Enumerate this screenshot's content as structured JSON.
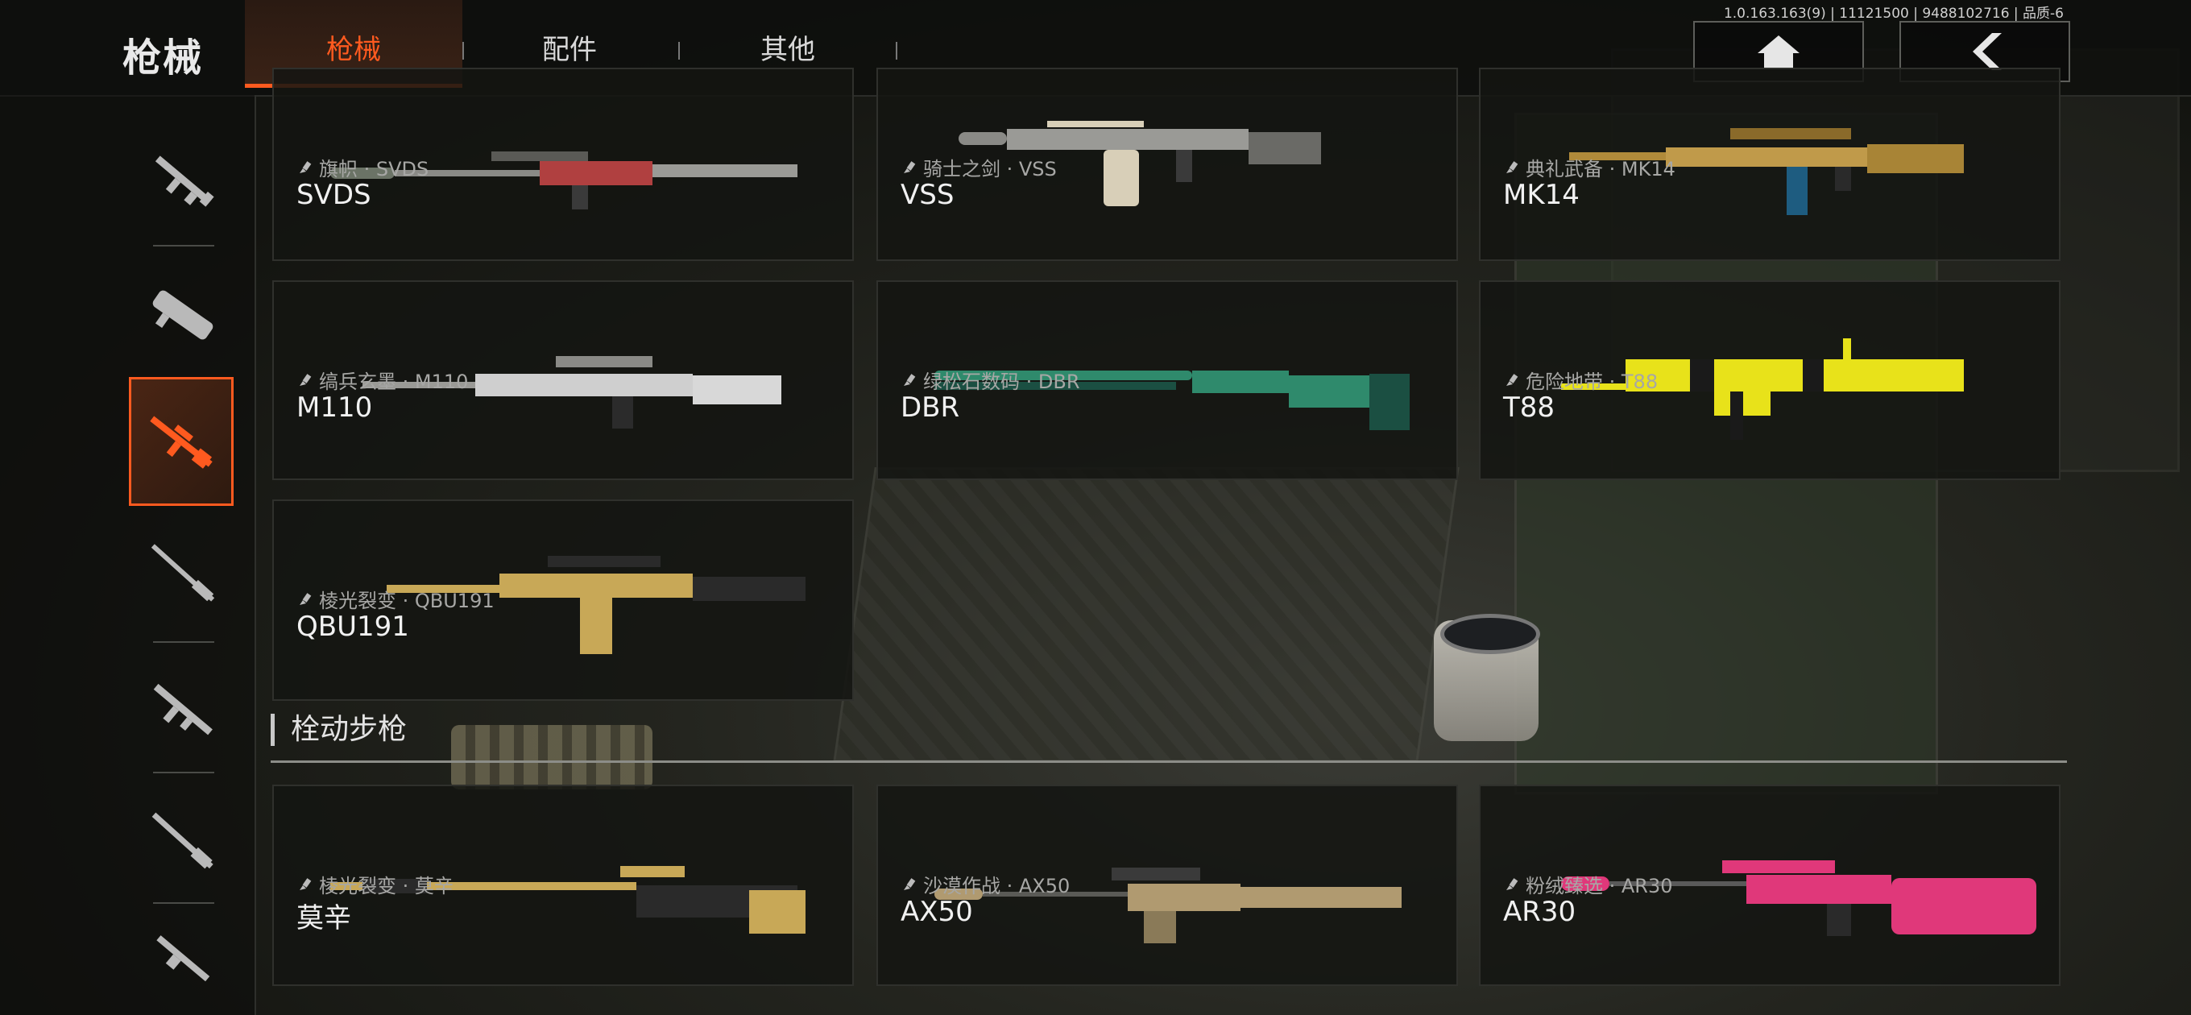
{
  "meta": {
    "version": "1.0.163.163(9) | 11121500 | 9488102716 | 品质-6"
  },
  "header": {
    "title": "枪械",
    "tabs": [
      {
        "label": "枪械"
      },
      {
        "label": "配件"
      },
      {
        "label": "其他"
      }
    ]
  },
  "icons": {
    "home": "home-icon",
    "back": "chevron-left-icon",
    "sidebar": [
      "assault-rifle-icon",
      "smg-icon",
      "dmr-icon",
      "sniper-icon",
      "rifle-icon",
      "shotgun-icon",
      "lmg-icon"
    ],
    "skin_tag": "paint-brush-icon"
  },
  "colors": {
    "accent": "#ff5a1f",
    "panel": "#141512"
  },
  "cards": [
    {
      "skin": "旗帜 · SVDS",
      "name": "SVDS",
      "palette": [
        "#6b7366",
        "#b04040"
      ]
    },
    {
      "skin": "骑士之剑 · VSS",
      "name": "VSS",
      "palette": [
        "#8a8a86",
        "#d8cfb8"
      ]
    },
    {
      "skin": "典礼武备 · MK14",
      "name": "MK14",
      "palette": [
        "#b08a3a",
        "#1e5c80"
      ]
    },
    {
      "skin": "缟兵玄墨 · M110",
      "name": "M110",
      "palette": [
        "#cfcfcf",
        "#2b2b2b"
      ]
    },
    {
      "skin": "绿松石数码 · DBR",
      "name": "DBR",
      "palette": [
        "#2f8a6c",
        "#1b4f42"
      ]
    },
    {
      "skin": "危险地带 · T88",
      "name": "T88",
      "palette": [
        "#e8e21a",
        "#1a1a1a"
      ]
    },
    {
      "skin": "棱光裂变 · QBU191",
      "name": "QBU191",
      "palette": [
        "#c8a857",
        "#2a2a2a"
      ]
    }
  ],
  "section": {
    "title": "栓动步枪"
  },
  "bolt_cards": [
    {
      "skin": "棱光裂变 · 莫辛",
      "name": "莫辛",
      "palette": [
        "#c8a857",
        "#2a2a2a"
      ]
    },
    {
      "skin": "沙漠作战 · AX50",
      "name": "AX50",
      "palette": [
        "#b09a70",
        "#3a3a3a"
      ]
    },
    {
      "skin": "粉绒臻选 · AR30",
      "name": "AR30",
      "palette": [
        "#e0387a",
        "#2a2a2a"
      ]
    }
  ]
}
